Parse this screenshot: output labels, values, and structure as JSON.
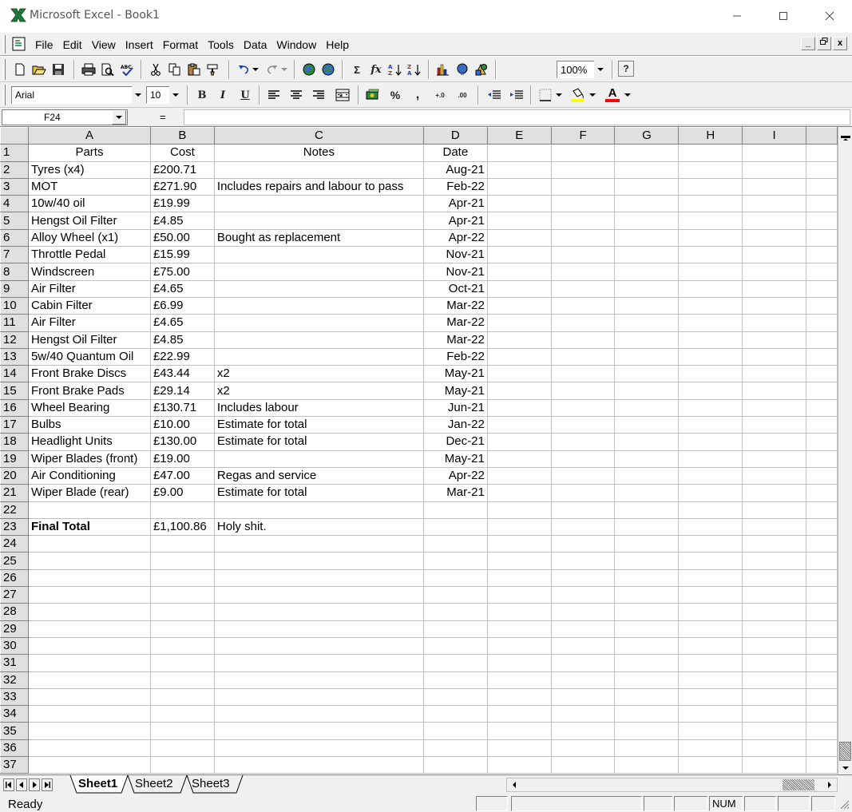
{
  "window": {
    "title": "Microsoft Excel - Book1",
    "minimize": "—",
    "maximize": "☐",
    "close": "✕"
  },
  "menu": {
    "items": [
      "File",
      "Edit",
      "View",
      "Insert",
      "Format",
      "Tools",
      "Data",
      "Window",
      "Help"
    ],
    "mdi_min": "_",
    "mdi_restore": "🗗",
    "mdi_close": "x"
  },
  "toolbar": {
    "zoom": "100%",
    "font_name": "Arial",
    "font_size": "10",
    "bold_label": "B",
    "italic_label": "I",
    "underline_label": "U",
    "percent_label": "%",
    "comma_label": ",",
    "sum_label": "Σ",
    "fx_label": "fx",
    "help_label": "?",
    "inc_decimal_label": "+.0",
    "dec_decimal_label": ".00",
    "font_color_label": "A"
  },
  "formula_bar": {
    "name_box": "F24",
    "equals": "=",
    "value": ""
  },
  "grid": {
    "columns": [
      "A",
      "B",
      "C",
      "D",
      "E",
      "F",
      "G",
      "H",
      "I"
    ],
    "rows": [
      {
        "n": "1",
        "a": "Parts",
        "b": "Cost",
        "c": "Notes",
        "d": "Date",
        "header": true
      },
      {
        "n": "2",
        "a": "Tyres (x4)",
        "b": "£200.71",
        "c": "",
        "d": "Aug-21"
      },
      {
        "n": "3",
        "a": "MOT",
        "b": "£271.90",
        "c": "Includes repairs and labour to pass",
        "d": "Feb-22"
      },
      {
        "n": "4",
        "a": "10w/40 oil",
        "b": "£19.99",
        "c": "",
        "d": "Apr-21"
      },
      {
        "n": "5",
        "a": "Hengst Oil Filter",
        "b": "£4.85",
        "c": "",
        "d": "Apr-21"
      },
      {
        "n": "6",
        "a": "Alloy Wheel (x1)",
        "b": "£50.00",
        "c": "Bought as replacement",
        "d": "Apr-22"
      },
      {
        "n": "7",
        "a": "Throttle Pedal",
        "b": "£15.99",
        "c": "",
        "d": "Nov-21"
      },
      {
        "n": "8",
        "a": "Windscreen",
        "b": "£75.00",
        "c": "",
        "d": "Nov-21"
      },
      {
        "n": "9",
        "a": "Air Filter",
        "b": "£4.65",
        "c": "",
        "d": "Oct-21"
      },
      {
        "n": "10",
        "a": "Cabin Filter",
        "b": "£6.99",
        "c": "",
        "d": "Mar-22"
      },
      {
        "n": "11",
        "a": "Air Filter",
        "b": "£4.65",
        "c": "",
        "d": "Mar-22"
      },
      {
        "n": "12",
        "a": "Hengst Oil Filter",
        "b": "£4.85",
        "c": "",
        "d": "Mar-22"
      },
      {
        "n": "13",
        "a": "5w/40 Quantum Oil",
        "b": "£22.99",
        "c": "",
        "d": "Feb-22"
      },
      {
        "n": "14",
        "a": "Front Brake Discs",
        "b": "£43.44",
        "c": "x2",
        "d": "May-21"
      },
      {
        "n": "15",
        "a": "Front Brake Pads",
        "b": "£29.14",
        "c": "x2",
        "d": "May-21"
      },
      {
        "n": "16",
        "a": "Wheel Bearing",
        "b": "£130.71",
        "c": "Includes labour",
        "d": "Jun-21"
      },
      {
        "n": "17",
        "a": "Bulbs",
        "b": "£10.00",
        "c": "Estimate for total",
        "d": "Jan-22"
      },
      {
        "n": "18",
        "a": "Headlight Units",
        "b": "£130.00",
        "c": "Estimate for total",
        "d": "Dec-21"
      },
      {
        "n": "19",
        "a": "Wiper Blades (front)",
        "b": "£19.00",
        "c": "",
        "d": "May-21"
      },
      {
        "n": "20",
        "a": "Air Conditioning",
        "b": "£47.00",
        "c": "Regas and service",
        "d": "Apr-22"
      },
      {
        "n": "21",
        "a": "Wiper Blade (rear)",
        "b": "£9.00",
        "c": "Estimate for total",
        "d": "Mar-21"
      },
      {
        "n": "22",
        "a": "",
        "b": "",
        "c": "",
        "d": ""
      },
      {
        "n": "23",
        "a": "Final Total",
        "b": "£1,100.86",
        "c": "Holy shit.",
        "d": "",
        "bold_a": true
      },
      {
        "n": "24",
        "a": "",
        "b": "",
        "c": "",
        "d": ""
      },
      {
        "n": "25",
        "a": "",
        "b": "",
        "c": "",
        "d": ""
      },
      {
        "n": "26",
        "a": "",
        "b": "",
        "c": "",
        "d": ""
      },
      {
        "n": "27",
        "a": "",
        "b": "",
        "c": "",
        "d": ""
      },
      {
        "n": "28",
        "a": "",
        "b": "",
        "c": "",
        "d": ""
      },
      {
        "n": "29",
        "a": "",
        "b": "",
        "c": "",
        "d": ""
      },
      {
        "n": "30",
        "a": "",
        "b": "",
        "c": "",
        "d": ""
      },
      {
        "n": "31",
        "a": "",
        "b": "",
        "c": "",
        "d": ""
      },
      {
        "n": "32",
        "a": "",
        "b": "",
        "c": "",
        "d": ""
      },
      {
        "n": "33",
        "a": "",
        "b": "",
        "c": "",
        "d": ""
      },
      {
        "n": "34",
        "a": "",
        "b": "",
        "c": "",
        "d": ""
      },
      {
        "n": "35",
        "a": "",
        "b": "",
        "c": "",
        "d": ""
      },
      {
        "n": "36",
        "a": "",
        "b": "",
        "c": "",
        "d": ""
      },
      {
        "n": "37",
        "a": "",
        "b": "",
        "c": "",
        "d": ""
      }
    ]
  },
  "sheets": {
    "tabs": [
      "Sheet1",
      "Sheet2",
      "Sheet3"
    ],
    "active": "Sheet1"
  },
  "status": {
    "text": "Ready",
    "num": "NUM"
  },
  "colors": {
    "app_green": "#1f7a3a",
    "chrome": "#f0f0f0",
    "grid_line": "#c0c0c0"
  }
}
